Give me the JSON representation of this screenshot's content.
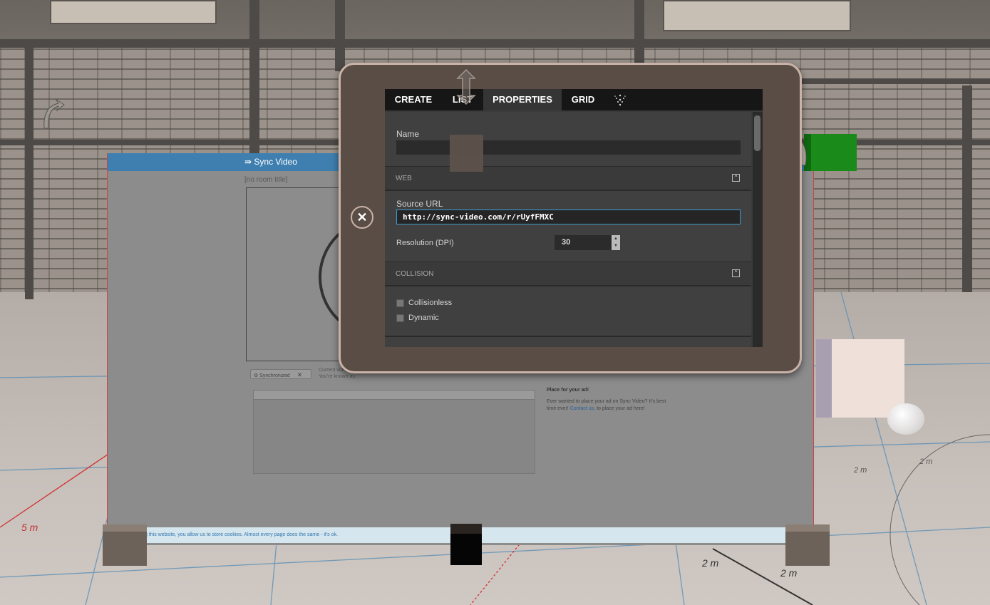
{
  "tabs": [
    {
      "label": "CREATE"
    },
    {
      "label": "LIST"
    },
    {
      "label": "PROPERTIES"
    },
    {
      "label": "GRID"
    }
  ],
  "properties": {
    "name_label": "Name",
    "name_value": "",
    "web_section": "WEB",
    "source_url_label": "Source URL",
    "source_url_value": "http://sync-video.com/r/rUyfFMXC",
    "resolution_label": "Resolution (DPI)",
    "resolution_value": "30",
    "collision_section": "COLLISION",
    "collisionless_label": "Collisionless",
    "dynamic_label": "Dynamic"
  },
  "web_page": {
    "logo": "Sync Video",
    "room_title": "[no room title]",
    "sync_label": "Synchronized",
    "current_video_note": "Current video",
    "known_as_note": "You're known as",
    "ad_title": "Place for your ad!",
    "ad_text": "Ever wanted to place your ad on Sync Video? It's best time ever!",
    "ad_link": "Contact us,",
    "ad_text_end": "to place your ad here!",
    "cookie_text": "g this website, you allow us to store cookies. Almost every page does the same - it's ok."
  },
  "floor_labels": [
    "5 m",
    "2 m",
    "2 m",
    "2 m",
    "2 m"
  ],
  "colors": {
    "accent_blue": "#3f7fb0",
    "tablet_frame": "#5a4d45",
    "tab_bar": "#161616"
  }
}
